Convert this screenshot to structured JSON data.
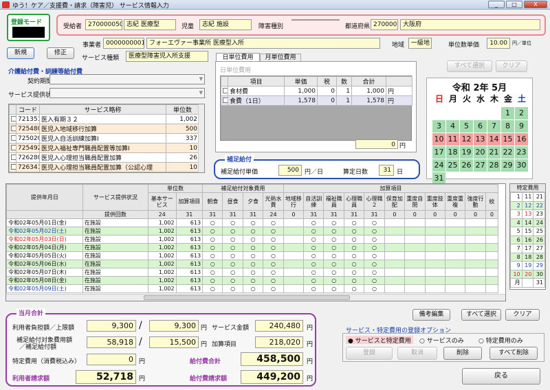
{
  "window": {
    "title": "ゆう！ケア／支援費・請求（障害児） サービス情報入力",
    "min": "_",
    "max": "□",
    "close": "X"
  },
  "mode": {
    "label": "登録モード",
    "value": ""
  },
  "header": {
    "recipient_label": "受給者",
    "recipient_no": "2700000503",
    "recipient_name": "志紀 医療型",
    "child_label": "児童",
    "child_name": "志紀 施設",
    "disability_label": "障害種別",
    "disability_value": "",
    "pref_label": "都道府県",
    "pref_code": "270000",
    "pref_name": "大阪府"
  },
  "office": {
    "label": "事業者",
    "code": "0000000001",
    "name": "フォーエヴァー事業所 医療型入所",
    "area_label": "地域",
    "area_value": "一級地",
    "unit_price_label": "単位数単価",
    "unit_price_value": "10.00",
    "unit_price_suffix": "円／単位"
  },
  "buttons": {
    "new": "新規",
    "edit": "修正",
    "select_all_top": "すべて選択",
    "clear_top": "クリア",
    "bikou": "備考編集",
    "select_all": "すべて選択",
    "clear": "クリア",
    "register": "登録",
    "cancel": "取消",
    "delete": "削除",
    "delete_all": "すべて削除",
    "back": "戻る"
  },
  "service_type": {
    "label": "サービス種類",
    "value": "医療型障害児入所支援"
  },
  "kaigo": {
    "title": "介護給付費・訓練等給付費",
    "contract_label": "契約期間",
    "contract_value": "",
    "status_label": "サービス提供状況",
    "status_value": ""
  },
  "service_list": {
    "headers": [
      "コード",
      "サービス略称",
      "単位数"
    ],
    "rows": [
      {
        "code": "721351",
        "name": "医入有期３２",
        "units": "1,002",
        "hl": false
      },
      {
        "code": "725480",
        "name": "医児入地域移行加算",
        "units": "500",
        "hl": true
      },
      {
        "code": "725020",
        "name": "医児入自活訓練加算Ⅰ",
        "units": "337",
        "hl": false
      },
      {
        "code": "725492",
        "name": "医児入福祉専門職員配置等加算Ⅰ",
        "units": "10",
        "hl": true
      },
      {
        "code": "726280",
        "name": "医児入心理担当職員配置加算",
        "units": "26",
        "hl": false
      },
      {
        "code": "726341",
        "name": "医児入心理担当職員配置加算（公認心理",
        "units": "10",
        "hl": true
      },
      {
        "code": "725110",
        "name": "医児入重度重複障害児加算",
        "units": "111",
        "hl": false
      }
    ]
  },
  "tabs": {
    "tab1": "日単位費用",
    "tab2": "月単位費用"
  },
  "daily": {
    "title": "日単位費用",
    "headers": [
      "項目",
      "単価",
      "税",
      "数",
      "合計"
    ],
    "rows": [
      {
        "item": "食材費",
        "price": "1,000",
        "tax": "0",
        "qty": "1",
        "total": "1,000",
        "unit": "円"
      },
      {
        "item": "食費（1日）",
        "price": "1,578",
        "tax": "0",
        "qty": "1",
        "total": "1,578",
        "unit": "円"
      }
    ],
    "sum": "0",
    "sum_unit": "円"
  },
  "hosoku": {
    "title": "補足給付",
    "unit_label": "補足給付単価",
    "unit_value": "500",
    "unit_suffix": "円／日",
    "days_label": "算定日数",
    "days_value": "31",
    "days_suffix": "日"
  },
  "calendar": {
    "title": "令和 2年 5月",
    "weekdays": [
      "日",
      "月",
      "火",
      "水",
      "木",
      "金",
      "土"
    ],
    "weeks": [
      [
        "",
        "",
        "",
        "",
        "",
        "1",
        "2"
      ],
      [
        "3",
        "4",
        "5",
        "6",
        "7",
        "8",
        "9"
      ],
      [
        "10",
        "11",
        "12",
        "13",
        "14",
        "15",
        "16"
      ],
      [
        "17",
        "18",
        "19",
        "20",
        "21",
        "22",
        "23"
      ],
      [
        "24",
        "25",
        "26",
        "27",
        "28",
        "29",
        "30"
      ],
      [
        "31",
        "",
        "",
        "",
        "",
        "",
        ""
      ]
    ]
  },
  "main_table": {
    "h_date": "提供年月日",
    "h_status": "サービス提供状況",
    "h_units": "単位数",
    "h_hosoku": "補足給付対象費用",
    "h_kasan": "加算項目",
    "sub_headers": [
      "基本サービス",
      "加算項目",
      "朝食",
      "昼食",
      "夕食",
      "光熱水費",
      "地域移行",
      "自活訓練",
      "福祉職員",
      "心理職員",
      "心理職２",
      "保育加配",
      "重度自閉",
      "重度肢体",
      "重度重複",
      "強度行動",
      "紋"
    ],
    "count_label": "提供回数",
    "counts": [
      "24",
      "31",
      "31",
      "31",
      "31",
      "24",
      "0",
      "31",
      "31",
      "31",
      "31",
      "0",
      "0",
      "0",
      "0",
      "0",
      "0"
    ],
    "rows": [
      {
        "date": "令和02年05月01日(金)",
        "color": "",
        "status": "在施設",
        "base": "1,002",
        "kasan": "613"
      },
      {
        "date": "令和02年05月02日(土)",
        "color": "blue",
        "status": "在施設",
        "base": "1,002",
        "kasan": "613"
      },
      {
        "date": "令和02年05月03日(日)",
        "color": "red",
        "status": "在施設",
        "base": "1,002",
        "kasan": "613"
      },
      {
        "date": "令和02年05月04日(月)",
        "color": "",
        "status": "在施設",
        "base": "1,002",
        "kasan": "613"
      },
      {
        "date": "令和02年05月05日(火)",
        "color": "",
        "status": "在施設",
        "base": "1,002",
        "kasan": "613"
      },
      {
        "date": "令和02年05月06日(水)",
        "color": "",
        "status": "在施設",
        "base": "1,002",
        "kasan": "613"
      },
      {
        "date": "令和02年05月07日(木)",
        "color": "",
        "status": "在施設",
        "base": "1,002",
        "kasan": "613"
      },
      {
        "date": "令和02年05月08日(金)",
        "color": "",
        "status": "在施設",
        "base": "1,002",
        "kasan": "613"
      },
      {
        "date": "令和02年05月09日(土)",
        "color": "blue",
        "status": "在施設",
        "base": "1,002",
        "kasan": "613"
      }
    ],
    "mark": "○"
  },
  "special": {
    "title": "特定費用",
    "rows": [
      [
        "1",
        "11",
        "21"
      ],
      [
        "2",
        "12",
        "22"
      ],
      [
        "3",
        "13",
        "23"
      ],
      [
        "4",
        "14",
        "24"
      ],
      [
        "5",
        "15",
        "25"
      ],
      [
        "6",
        "16",
        "26"
      ],
      [
        "7",
        "17",
        "27"
      ],
      [
        "8",
        "18",
        "28"
      ],
      [
        "9",
        "19",
        "29"
      ],
      [
        "10",
        "20",
        "30"
      ],
      [
        "月",
        "",
        "31"
      ]
    ]
  },
  "totals": {
    "title": "当月合計",
    "burden_label": "利用者負担額／上限額",
    "burden_value": "9,300",
    "burden_limit": "9,300",
    "yen": "円",
    "hosoku_label1": "補足給付対象費用額",
    "hosoku_label2": "／補足給付額",
    "hosoku_value": "58,918",
    "hosoku_limit": "15,500",
    "special_label": "特定費用（消費税込み）",
    "special_value": "0",
    "user_bill_label": "利用者請求額",
    "user_bill_value": "52,718",
    "service_amount_label": "サービス金額",
    "service_amount_value": "240,480",
    "kasan_label": "加算項目",
    "kasan_value": "218,020",
    "benefit_label": "給付費合計",
    "benefit_value": "458,500",
    "benefit_bill_label": "給付費請求額",
    "benefit_bill_value": "449,200",
    "slash": "/"
  },
  "options": {
    "title": "サービス・特定費用の登録オプション",
    "opt1": "サービスと特定費用",
    "opt2": "サービスのみ",
    "opt3": "特定費用のみ"
  }
}
